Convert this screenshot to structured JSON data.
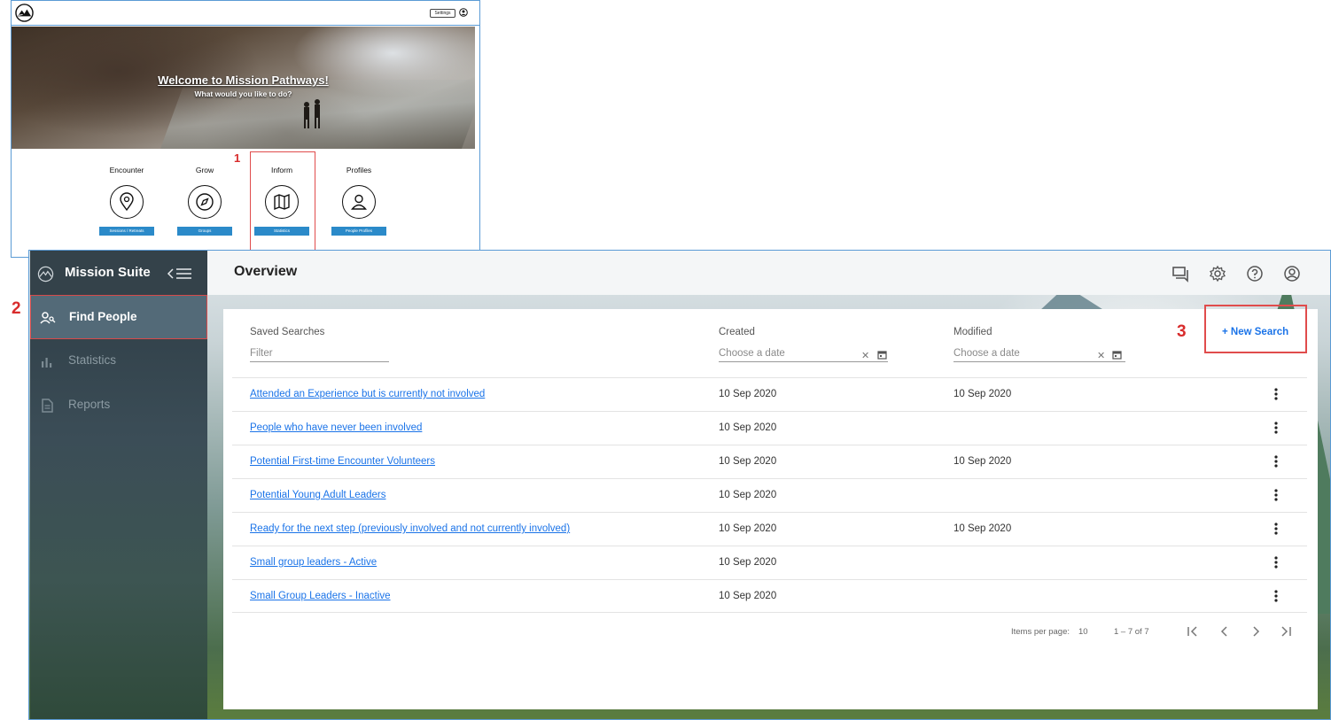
{
  "landing": {
    "settings_label": "Settings",
    "hero_title": "Welcome to Mission Pathways!",
    "hero_subtitle": "What would you like to do?",
    "tiles": [
      {
        "title": "Encounter",
        "button": "Sessions / Retreats",
        "icon": "map-pin-icon"
      },
      {
        "title": "Grow",
        "button": "Groups",
        "icon": "compass-icon"
      },
      {
        "title": "Inform",
        "button": "Statistics",
        "icon": "map-icon"
      },
      {
        "title": "Profiles",
        "button": "People Profiles",
        "icon": "person-icon"
      }
    ]
  },
  "callouts": {
    "one": "1",
    "two": "2",
    "three": "3"
  },
  "app": {
    "title": "Mission Suite",
    "page_title": "Overview",
    "nav": [
      {
        "label": "Find People",
        "icon": "people-search-icon"
      },
      {
        "label": "Statistics",
        "icon": "bar-chart-icon"
      },
      {
        "label": "Reports",
        "icon": "document-icon"
      }
    ],
    "top_icons": [
      "chat-icon",
      "gear-icon",
      "help-icon",
      "account-icon"
    ]
  },
  "saved_searches": {
    "headers": {
      "name": "Saved Searches",
      "created": "Created",
      "modified": "Modified"
    },
    "filter_placeholder": "Filter",
    "date_placeholder": "Choose a date",
    "new_search_label": "+ New Search",
    "rows": [
      {
        "name": "Attended an Experience but is currently not involved",
        "created": "10 Sep 2020",
        "modified": "10 Sep 2020"
      },
      {
        "name": "People who have never been involved",
        "created": "10 Sep 2020",
        "modified": ""
      },
      {
        "name": "Potential First-time Encounter Volunteers",
        "created": "10 Sep 2020",
        "modified": "10 Sep 2020"
      },
      {
        "name": "Potential Young Adult Leaders",
        "created": "10 Sep 2020",
        "modified": ""
      },
      {
        "name": "Ready for the next step (previously involved and not currently involved)",
        "created": "10 Sep 2020",
        "modified": "10 Sep 2020"
      },
      {
        "name": "Small group leaders - Active",
        "created": "10 Sep 2020",
        "modified": ""
      },
      {
        "name": "Small Group Leaders - Inactive",
        "created": "10 Sep 2020",
        "modified": ""
      }
    ],
    "pager": {
      "items_per_page_label": "Items per page:",
      "items_per_page": "10",
      "range": "1 – 7 of 7"
    }
  }
}
